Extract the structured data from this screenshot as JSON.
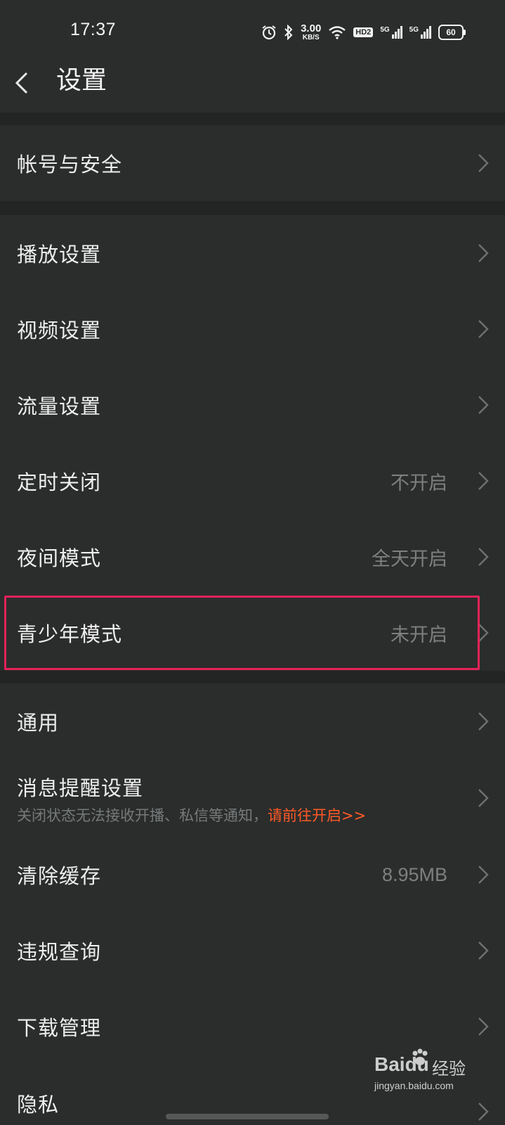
{
  "status_bar": {
    "time": "17:37",
    "net_speed_value": "3.00",
    "net_speed_unit": "KB/S",
    "hd_badge": "HD2",
    "signal1_label": "5G",
    "signal2_label": "5G",
    "battery": "60",
    "icons": [
      "alarm-icon",
      "bluetooth-icon",
      "wifi-icon",
      "hd-icon",
      "signal-icon",
      "signal-icon",
      "battery-icon"
    ]
  },
  "header": {
    "title": "设置",
    "back_icon": "chevron-left-icon"
  },
  "settings": {
    "account": {
      "label": "帐号与安全"
    },
    "playback": {
      "label": "播放设置"
    },
    "video": {
      "label": "视频设置"
    },
    "traffic": {
      "label": "流量设置"
    },
    "timer": {
      "label": "定时关闭",
      "value": "不开启"
    },
    "night": {
      "label": "夜间模式",
      "value": "全天开启"
    },
    "teen": {
      "label": "青少年模式",
      "value": "未开启"
    },
    "general": {
      "label": "通用"
    },
    "notify": {
      "label": "消息提醒设置",
      "sub_text": "关闭状态无法接收开播、私信等通知，",
      "sub_link": "请前往开启>>"
    },
    "cache": {
      "label": "清除缓存",
      "value": "8.95MB"
    },
    "violation": {
      "label": "违规查询"
    },
    "download": {
      "label": "下载管理"
    },
    "privacy": {
      "label": "隐私"
    }
  },
  "watermark": {
    "logo_a": "Bai",
    "logo_b": "du",
    "cn": "经验",
    "url": "jingyan.baidu.com"
  },
  "colors": {
    "background": "#2b2d2c",
    "section_gap": "#232524",
    "text": "#eeeeee",
    "secondary_text": "#7d807e",
    "link": "#ff5a26",
    "highlight": "#e7225a"
  }
}
